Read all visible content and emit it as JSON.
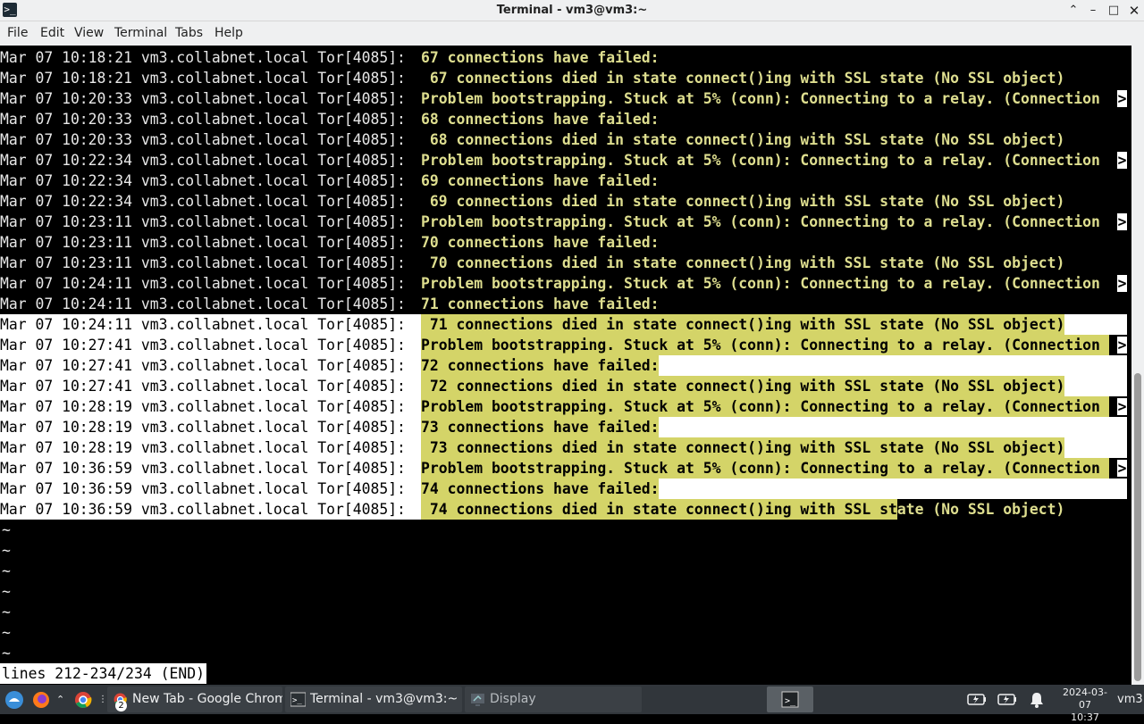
{
  "window": {
    "title": "Terminal - vm3@vm3:~",
    "minimize_icon": "window-minimize-icon",
    "maximize_icon": "window-maximize-icon",
    "close_icon": "window-close-icon",
    "collapse_icon": "window-collapse-icon"
  },
  "menu": [
    "File",
    "Edit",
    "View",
    "Terminal",
    "Tabs",
    "Help"
  ],
  "terminal": {
    "lines": [
      {
        "prefix": "Mar 07 10:18:21 vm3.collabnet.local Tor[4085]: ",
        "msg": "67 connections have failed:"
      },
      {
        "prefix": "Mar 07 10:18:21 vm3.collabnet.local Tor[4085]: ",
        "msg": " 67 connections died in state connect()ing with SSL state (No SSL object)"
      },
      {
        "prefix": "Mar 07 10:20:33 vm3.collabnet.local Tor[4085]: ",
        "msg": "Problem bootstrapping. Stuck at 5% (conn): Connecting to a relay. (Connection ",
        "more": ">"
      },
      {
        "prefix": "Mar 07 10:20:33 vm3.collabnet.local Tor[4085]: ",
        "msg": "68 connections have failed:"
      },
      {
        "prefix": "Mar 07 10:20:33 vm3.collabnet.local Tor[4085]: ",
        "msg": " 68 connections died in state connect()ing with SSL state (No SSL object)"
      },
      {
        "prefix": "Mar 07 10:22:34 vm3.collabnet.local Tor[4085]: ",
        "msg": "Problem bootstrapping. Stuck at 5% (conn): Connecting to a relay. (Connection ",
        "more": ">"
      },
      {
        "prefix": "Mar 07 10:22:34 vm3.collabnet.local Tor[4085]: ",
        "msg": "69 connections have failed:"
      },
      {
        "prefix": "Mar 07 10:22:34 vm3.collabnet.local Tor[4085]: ",
        "msg": " 69 connections died in state connect()ing with SSL state (No SSL object)"
      },
      {
        "prefix": "Mar 07 10:23:11 vm3.collabnet.local Tor[4085]: ",
        "msg": "Problem bootstrapping. Stuck at 5% (conn): Connecting to a relay. (Connection ",
        "more": ">"
      },
      {
        "prefix": "Mar 07 10:23:11 vm3.collabnet.local Tor[4085]: ",
        "msg": "70 connections have failed:"
      },
      {
        "prefix": "Mar 07 10:23:11 vm3.collabnet.local Tor[4085]: ",
        "msg": " 70 connections died in state connect()ing with SSL state (No SSL object)"
      },
      {
        "prefix": "Mar 07 10:24:11 vm3.collabnet.local Tor[4085]: ",
        "msg": "Problem bootstrapping. Stuck at 5% (conn): Connecting to a relay. (Connection ",
        "more": ">"
      },
      {
        "prefix": "Mar 07 10:24:11 vm3.collabnet.local Tor[4085]: ",
        "msg": "71 connections have failed:"
      },
      {
        "prefix": "Mar 07 10:24:11 vm3.collabnet.local Tor[4085]: ",
        "msg": " 71 connections died in state connect()ing with SSL state (No SSL object)",
        "sel": true
      },
      {
        "prefix": "Mar 07 10:27:41 vm3.collabnet.local Tor[4085]: ",
        "msg": "Problem bootstrapping. Stuck at 5% (conn): Connecting to a relay. (Connection ",
        "more": ">",
        "sel": true
      },
      {
        "prefix": "Mar 07 10:27:41 vm3.collabnet.local Tor[4085]: ",
        "msg": "72 connections have failed:",
        "sel": true
      },
      {
        "prefix": "Mar 07 10:27:41 vm3.collabnet.local Tor[4085]: ",
        "msg": " 72 connections died in state connect()ing with SSL state (No SSL object)",
        "sel": true
      },
      {
        "prefix": "Mar 07 10:28:19 vm3.collabnet.local Tor[4085]: ",
        "msg": "Problem bootstrapping. Stuck at 5% (conn): Connecting to a relay. (Connection ",
        "more": ">",
        "sel": true
      },
      {
        "prefix": "Mar 07 10:28:19 vm3.collabnet.local Tor[4085]: ",
        "msg": "73 connections have failed:",
        "sel": true
      },
      {
        "prefix": "Mar 07 10:28:19 vm3.collabnet.local Tor[4085]: ",
        "msg": " 73 connections died in state connect()ing with SSL state (No SSL object)",
        "sel": true
      },
      {
        "prefix": "Mar 07 10:36:59 vm3.collabnet.local Tor[4085]: ",
        "msg": "Problem bootstrapping. Stuck at 5% (conn): Connecting to a relay. (Connection ",
        "more": ">",
        "sel": true
      },
      {
        "prefix": "Mar 07 10:36:59 vm3.collabnet.local Tor[4085]: ",
        "msg": "74 connections have failed:",
        "sel": true
      },
      {
        "prefix": "Mar 07 10:36:59 vm3.collabnet.local Tor[4085]: ",
        "msg": " 74 connections died in state connect()ing with SSL st",
        "msg_rest": "ate (No SSL object)",
        "sel": true,
        "partial": true
      }
    ],
    "tilde_lines": [
      "~",
      "~",
      "~",
      "~",
      "~",
      "~",
      "~"
    ],
    "status_line": "lines 212-234/234 (END)"
  },
  "taskbar": {
    "tasks": [
      {
        "label": "New Tab - Google Chrome",
        "badge": "2",
        "icon": "chrome-icon"
      },
      {
        "label": "Terminal - vm3@vm3:~",
        "icon": "terminal-icon"
      },
      {
        "label": "Display",
        "icon": "display-icon"
      }
    ],
    "clock": {
      "date": "2024-03-07",
      "time": "10:37"
    },
    "user": "vm3"
  }
}
